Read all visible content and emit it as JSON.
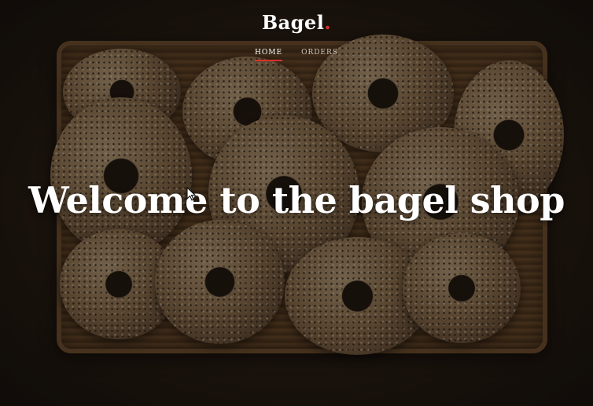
{
  "brand": {
    "name": "Bagel",
    "dot": "."
  },
  "nav": {
    "items": [
      {
        "label": "HOME",
        "active": true
      },
      {
        "label": "ORDERS",
        "active": false
      }
    ]
  },
  "hero": {
    "headline": "Welcome to the bagel shop",
    "image": "basket-of-bagels"
  },
  "colors": {
    "accent": "#d9302c",
    "text": "#ffffff"
  }
}
